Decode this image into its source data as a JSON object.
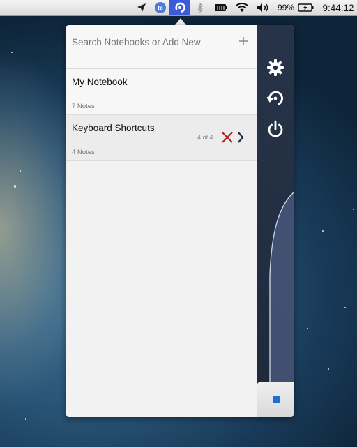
{
  "menubar": {
    "icons": [
      "cursor-arrow-icon",
      "te-app-icon",
      "sync-app-icon",
      "bluetooth-icon",
      "battery-dark-icon",
      "wifi-icon",
      "volume-icon",
      "battery-icon"
    ],
    "battery_percent": "99%",
    "clock": "9:44:12",
    "active_color": "#3b5bdb"
  },
  "search": {
    "placeholder": "Search Notebooks or Add New"
  },
  "notebooks": [
    {
      "title": "My Notebook",
      "count": "7 Notes"
    },
    {
      "title": "Keyboard Shortcuts",
      "count": "4 Notes",
      "pages": "4 of 4",
      "selected": true
    }
  ],
  "sidebar_buttons": [
    "gear-icon",
    "sync-icon",
    "power-icon"
  ],
  "colors": {
    "delete": "#b01c1c",
    "panel_dark": "#1f2a3d",
    "indicator": "#1f6fd1"
  }
}
